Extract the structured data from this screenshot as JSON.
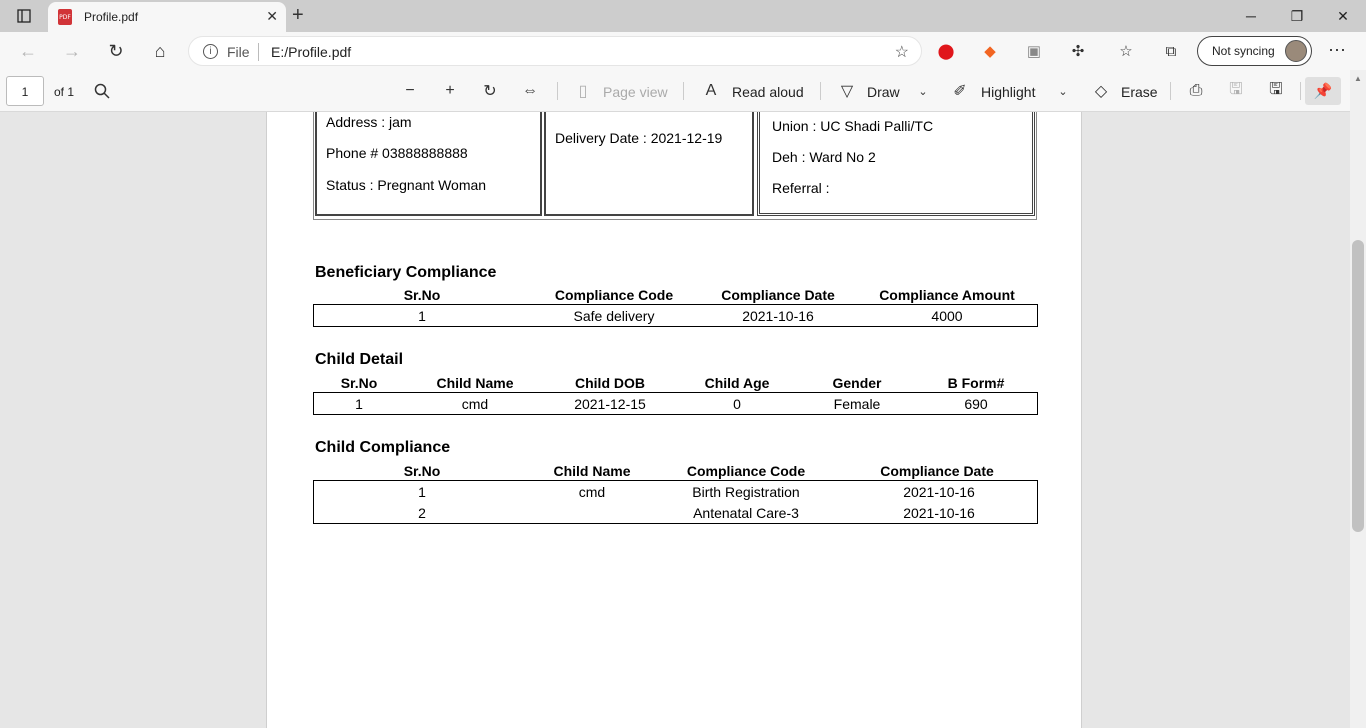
{
  "browser": {
    "tab_title": "Profile.pdf",
    "tab_badge": "PDF",
    "address_scheme": "File",
    "address_url": "E:/Profile.pdf",
    "sync_label": "Not syncing"
  },
  "pdf_toolbar": {
    "page_number": "1",
    "page_total": "of 1",
    "page_view": "Page view",
    "read_aloud": "Read aloud",
    "draw": "Draw",
    "highlight": "Highlight",
    "erase": "Erase"
  },
  "profile": {
    "address": "Address : jam",
    "phone": "Phone # 03888888888",
    "status": "Status : Pregnant Woman",
    "delivery_date": "Delivery Date : 2021-12-19",
    "union": "Union : UC Shadi Palli/TC",
    "deh": "Deh : Ward No 2",
    "referral": "Referral :"
  },
  "beneficiary_compliance": {
    "title": "Beneficiary Compliance",
    "headers": [
      "Sr.No",
      "Compliance Code",
      "Compliance Date",
      "Compliance Amount"
    ],
    "rows": [
      [
        "1",
        "Safe delivery",
        "2021-10-16",
        "4000"
      ]
    ]
  },
  "child_detail": {
    "title": "Child Detail",
    "headers": [
      "Sr.No",
      "Child Name",
      "Child DOB",
      "Child Age",
      "Gender",
      "B Form#"
    ],
    "rows": [
      [
        "1",
        "cmd",
        "2021-12-15",
        "0",
        "Female",
        "690"
      ]
    ]
  },
  "child_compliance": {
    "title": "Child Compliance",
    "headers": [
      "Sr.No",
      "Child Name",
      "Compliance Code",
      "Compliance Date"
    ],
    "rows": [
      [
        "1",
        "cmd",
        "Birth Registration",
        "2021-10-16"
      ],
      [
        "2",
        "",
        "Antenatal Care-3",
        "2021-10-16"
      ]
    ]
  }
}
